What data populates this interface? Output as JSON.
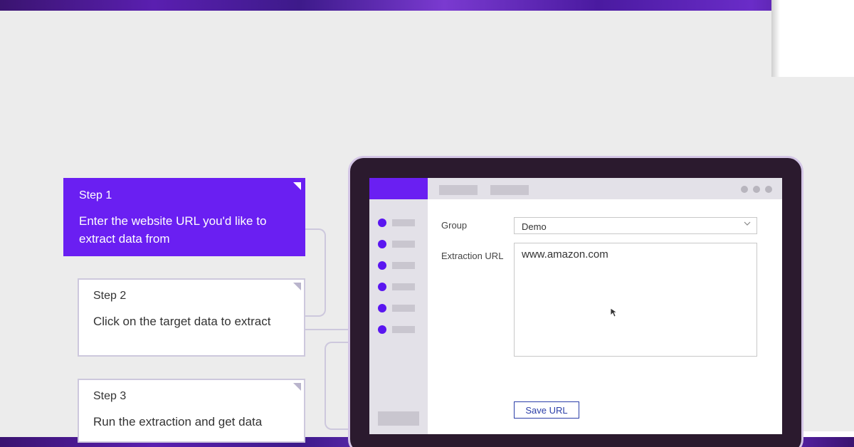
{
  "steps": [
    {
      "title": "Step 1",
      "description": "Enter the website URL you'd like to extract data from"
    },
    {
      "title": "Step 2",
      "description": "Click on the target data to extract"
    },
    {
      "title": "Step 3",
      "description": "Run the extraction and get data"
    }
  ],
  "form": {
    "group_label": "Group",
    "group_value": "Demo",
    "url_label": "Extraction URL",
    "url_value": "www.amazon.com",
    "save_label": "Save URL"
  },
  "colors": {
    "accent": "#6a1ff2",
    "laptop_frame": "#2b1a2e",
    "button_text": "#2b3ea8"
  },
  "icons": [
    "chevron-down-icon",
    "mouse-cursor-icon",
    "window-dot-icon",
    "corner-fold-icon"
  ]
}
